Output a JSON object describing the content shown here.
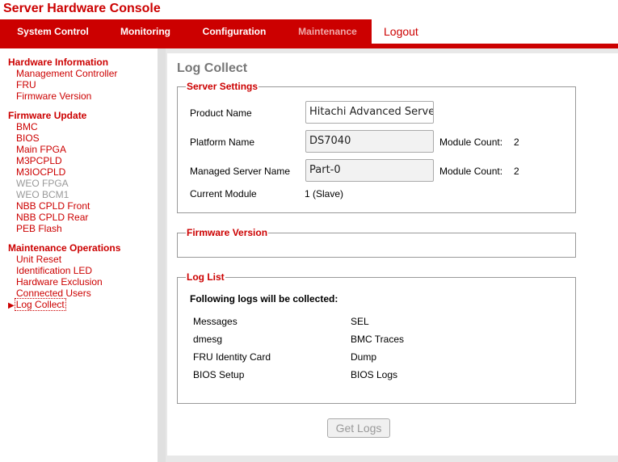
{
  "app": {
    "title": "Server Hardware Console"
  },
  "nav": {
    "tabs": [
      {
        "label": "System Control"
      },
      {
        "label": "Monitoring"
      },
      {
        "label": "Configuration"
      },
      {
        "label": "Maintenance",
        "active": true
      }
    ],
    "logout_label": "Logout"
  },
  "sidebar": {
    "groups": [
      {
        "title": "Hardware Information",
        "items": [
          "Management Controller",
          "FRU",
          "Firmware Version"
        ]
      },
      {
        "title": "Firmware Update",
        "items": [
          "BMC",
          "BIOS",
          "Main FPGA",
          "M3PCPLD",
          "M3IOCPLD",
          "WEO FPGA",
          "WEO BCM1",
          "NBB CPLD Front",
          "NBB CPLD Rear",
          "PEB Flash"
        ]
      },
      {
        "title": "Maintenance Operations",
        "items": [
          "Unit Reset",
          "Identification LED",
          "Hardware Exclusion",
          "Connected Users",
          "Log Collect"
        ]
      }
    ],
    "disabled_items": [
      "WEO FPGA",
      "WEO BCM1"
    ],
    "current_item": "Log Collect",
    "current_marker": "▶"
  },
  "page": {
    "title": "Log Collect",
    "server_settings": {
      "legend": "Server Settings",
      "product_name_label": "Product Name",
      "product_name_value": "Hitachi Advanced Server",
      "platform_name_label": "Platform Name",
      "platform_name_value": "DS7040",
      "module_count_label": "Module Count:",
      "module_count_value": "2",
      "managed_server_name_label": "Managed Server Name",
      "managed_server_name_value": "Part-0",
      "module_count_label_2": "Module Count:",
      "module_count_value_2": "2",
      "current_module_label": "Current Module",
      "current_module_value": "1 (Slave)"
    },
    "firmware_version": {
      "legend": "Firmware Version"
    },
    "log_list": {
      "legend": "Log List",
      "heading": "Following logs will be collected:",
      "left_items": [
        "Messages",
        "dmesg",
        "FRU Identity Card",
        "BIOS Setup"
      ],
      "right_items": [
        "SEL",
        "BMC Traces",
        "Dump",
        "BIOS Logs"
      ]
    },
    "get_logs_label": "Get Logs"
  },
  "colors": {
    "brand": "#cc0000",
    "nav_active": "#f0a8a8",
    "disabled": "#999999"
  }
}
